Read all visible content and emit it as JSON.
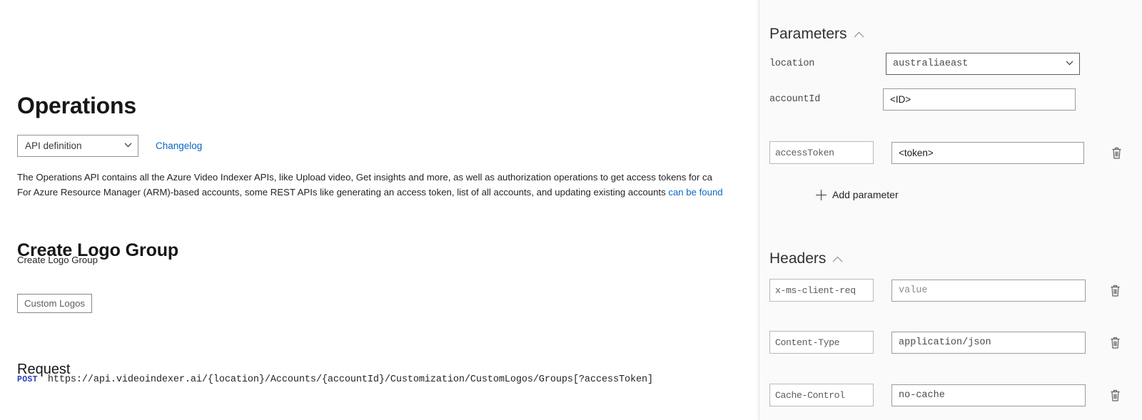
{
  "doc": {
    "page_title": "Operations",
    "api_definition_select": {
      "value": "API definition",
      "options": [
        "API definition"
      ],
      "chevron_icon": "chevron-down-icon"
    },
    "changelog_link": "Changelog",
    "description_line1": "The Operations API contains all the Azure Video Indexer APIs, like Upload video, Get insights and more, as well as authorization operations to get access tokens for ca",
    "description_line2_a": "For Azure Resource Manager (ARM)-based accounts, some REST APIs like generating an access token, list of all accounts, and updating existing accounts ",
    "description_line2_link": "can be found",
    "section_title": "Create Logo Group",
    "section_subtitle": "Create Logo Group",
    "tag_button": "Custom Logos",
    "request_heading": "Request",
    "request_method": "POST",
    "request_url": "https://api.videoindexer.ai/{location}/Accounts/{accountId}/Customization/CustomLogos/Groups[?accessToken]"
  },
  "panel": {
    "parameters": {
      "heading": "Parameters",
      "collapse_icon": "chevron-up-icon",
      "rows": [
        {
          "key_label": "location",
          "key_editable": false,
          "control": "select",
          "value": "australiaeast",
          "options": [
            "australiaeast"
          ],
          "chevron_icon": "chevron-down-icon",
          "deletable": false
        },
        {
          "key_label": "accountId",
          "key_editable": false,
          "control": "input",
          "value": "<ID>",
          "placeholder": "",
          "deletable": false
        },
        {
          "key_label": "accessToken",
          "key_editable": true,
          "control": "input",
          "value": "<token>",
          "placeholder": "",
          "deletable": true,
          "delete_icon": "trash-icon"
        }
      ],
      "add_label": "Add parameter",
      "add_icon": "plus-icon"
    },
    "headers": {
      "heading": "Headers",
      "collapse_icon": "chevron-up-icon",
      "rows": [
        {
          "key_label": "x-ms-client-req",
          "key_editable": true,
          "value": "",
          "placeholder": "value",
          "deletable": true,
          "delete_icon": "trash-icon"
        },
        {
          "key_label": "Content-Type",
          "key_editable": true,
          "value": "application/json",
          "placeholder": "value",
          "deletable": true,
          "delete_icon": "trash-icon"
        },
        {
          "key_label": "Cache-Control",
          "key_editable": true,
          "value": "no-cache",
          "placeholder": "value",
          "deletable": true,
          "delete_icon": "trash-icon"
        }
      ]
    }
  },
  "colors": {
    "link": "#0a67c2",
    "method": "#2b3bc2",
    "panel_bg": "#fafafa",
    "text": "#242424"
  }
}
